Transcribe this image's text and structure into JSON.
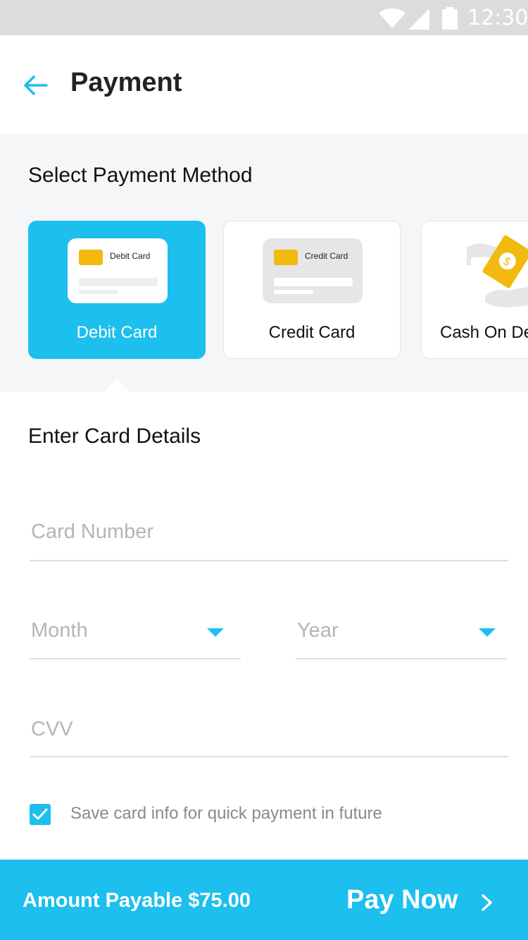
{
  "status_bar": {
    "time": "12:30"
  },
  "header": {
    "title": "Payment"
  },
  "payment_methods": {
    "title": "Select Payment Method",
    "items": [
      {
        "label": "Debit Card",
        "card_label": "Debit Card",
        "selected": true
      },
      {
        "label": "Credit Card",
        "card_label": "Credit Card",
        "selected": false
      },
      {
        "label": "Cash On Delivery",
        "selected": false
      }
    ]
  },
  "card_details": {
    "title": "Enter Card Details",
    "card_number_placeholder": "Card Number",
    "month_placeholder": "Month",
    "year_placeholder": "Year",
    "cvv_placeholder": "CVV",
    "save_card_label": "Save card info for quick payment in future",
    "save_card_checked": true
  },
  "footer": {
    "amount_label": "Amount Payable $75.00",
    "pay_button_label": "Pay Now"
  },
  "colors": {
    "accent": "#1cbfee",
    "chip": "#f2b90f",
    "section_bg": "#f5f6f8"
  }
}
